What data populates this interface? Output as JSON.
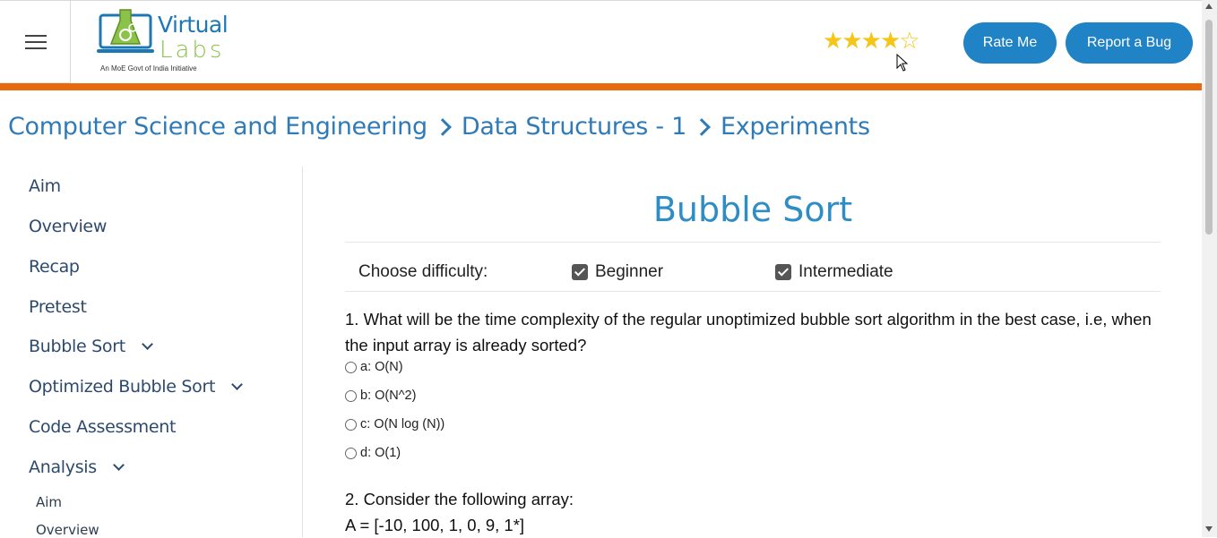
{
  "header": {
    "logo": {
      "line1": "Virtual",
      "line2": "Labs",
      "tagline": "An MoE Govt of India Initiative"
    },
    "rating": {
      "value": 4,
      "max": 5
    },
    "rate_button": "Rate Me",
    "bug_button": "Report a Bug"
  },
  "colors": {
    "accent": "#2083c6",
    "orange_bar": "#e86a10",
    "title": "#2f8dc6",
    "breadcrumb": "#2f7bb8"
  },
  "breadcrumb": [
    "Computer Science and Engineering",
    "Data Structures - 1",
    "Experiments"
  ],
  "sidebar": {
    "items": [
      {
        "label": "Aim"
      },
      {
        "label": "Overview"
      },
      {
        "label": "Recap"
      },
      {
        "label": "Pretest"
      },
      {
        "label": "Bubble Sort",
        "expandable": true
      },
      {
        "label": "Optimized Bubble Sort",
        "expandable": true
      },
      {
        "label": "Code Assessment"
      },
      {
        "label": "Analysis",
        "expandable": true
      }
    ],
    "subitems": [
      {
        "label": "Aim"
      },
      {
        "label": "Overview"
      }
    ]
  },
  "main": {
    "title": "Bubble Sort",
    "difficulty_label": "Choose difficulty:",
    "difficulties": [
      {
        "label": "Beginner",
        "checked": true
      },
      {
        "label": "Intermediate",
        "checked": true
      }
    ],
    "questions": [
      {
        "text": "1. What will be the time complexity of the regular unoptimized bubble sort algorithm in the best case, i.e, when the input array is already sorted?",
        "options": [
          "a: O(N)",
          "b: O(N^2)",
          "c: O(N log (N))",
          "d: O(1)"
        ]
      },
      {
        "text": "2. Consider the following array:",
        "line2": "A = [-10, 100, 1, 0, 9, 1*]"
      }
    ]
  }
}
